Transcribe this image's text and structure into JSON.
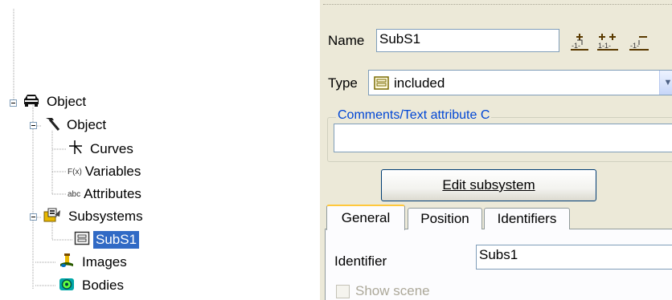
{
  "tree": {
    "root": {
      "label": "Object",
      "icon": "car-icon"
    },
    "object": {
      "label": "Object",
      "icon": "hammer-icon"
    },
    "curves": {
      "label": "Curves",
      "icon": "curves-icon"
    },
    "variables": {
      "label": "Variables",
      "prefix": "F(x)",
      "icon": "function-icon"
    },
    "attributes": {
      "label": "Attributes",
      "prefix": "abc",
      "icon": "text-attribute-icon"
    },
    "subsystems": {
      "label": "Subsystems",
      "icon": "subsystems-folder-icon"
    },
    "subs1": {
      "label": "SubS1",
      "icon": "subsystem-icon",
      "selected": true
    },
    "images": {
      "label": "Images",
      "icon": "image-icon"
    },
    "bodies": {
      "label": "Bodies",
      "icon": "body-icon"
    }
  },
  "panel": {
    "name_label": "Name",
    "name_value": "SubS1",
    "type_label": "Type",
    "type_value": "included",
    "comments_legend": "Comments/Text attribute C",
    "comments_value": "",
    "edit_button": "Edit subsystem",
    "tabs": [
      "General",
      "Position",
      "Identifiers"
    ],
    "active_tab": "General",
    "identifier_label": "Identifier",
    "identifier_value": "Subs1",
    "show_scene_label": "Show scene",
    "show_scene_checked": false,
    "toolbar_icons": [
      "add-before-icon",
      "add-both-icon",
      "add-after-icon"
    ]
  },
  "colors": {
    "selection": "#316ac5",
    "panel_bg": "#ece9d8",
    "legend_text": "#0046d5"
  }
}
